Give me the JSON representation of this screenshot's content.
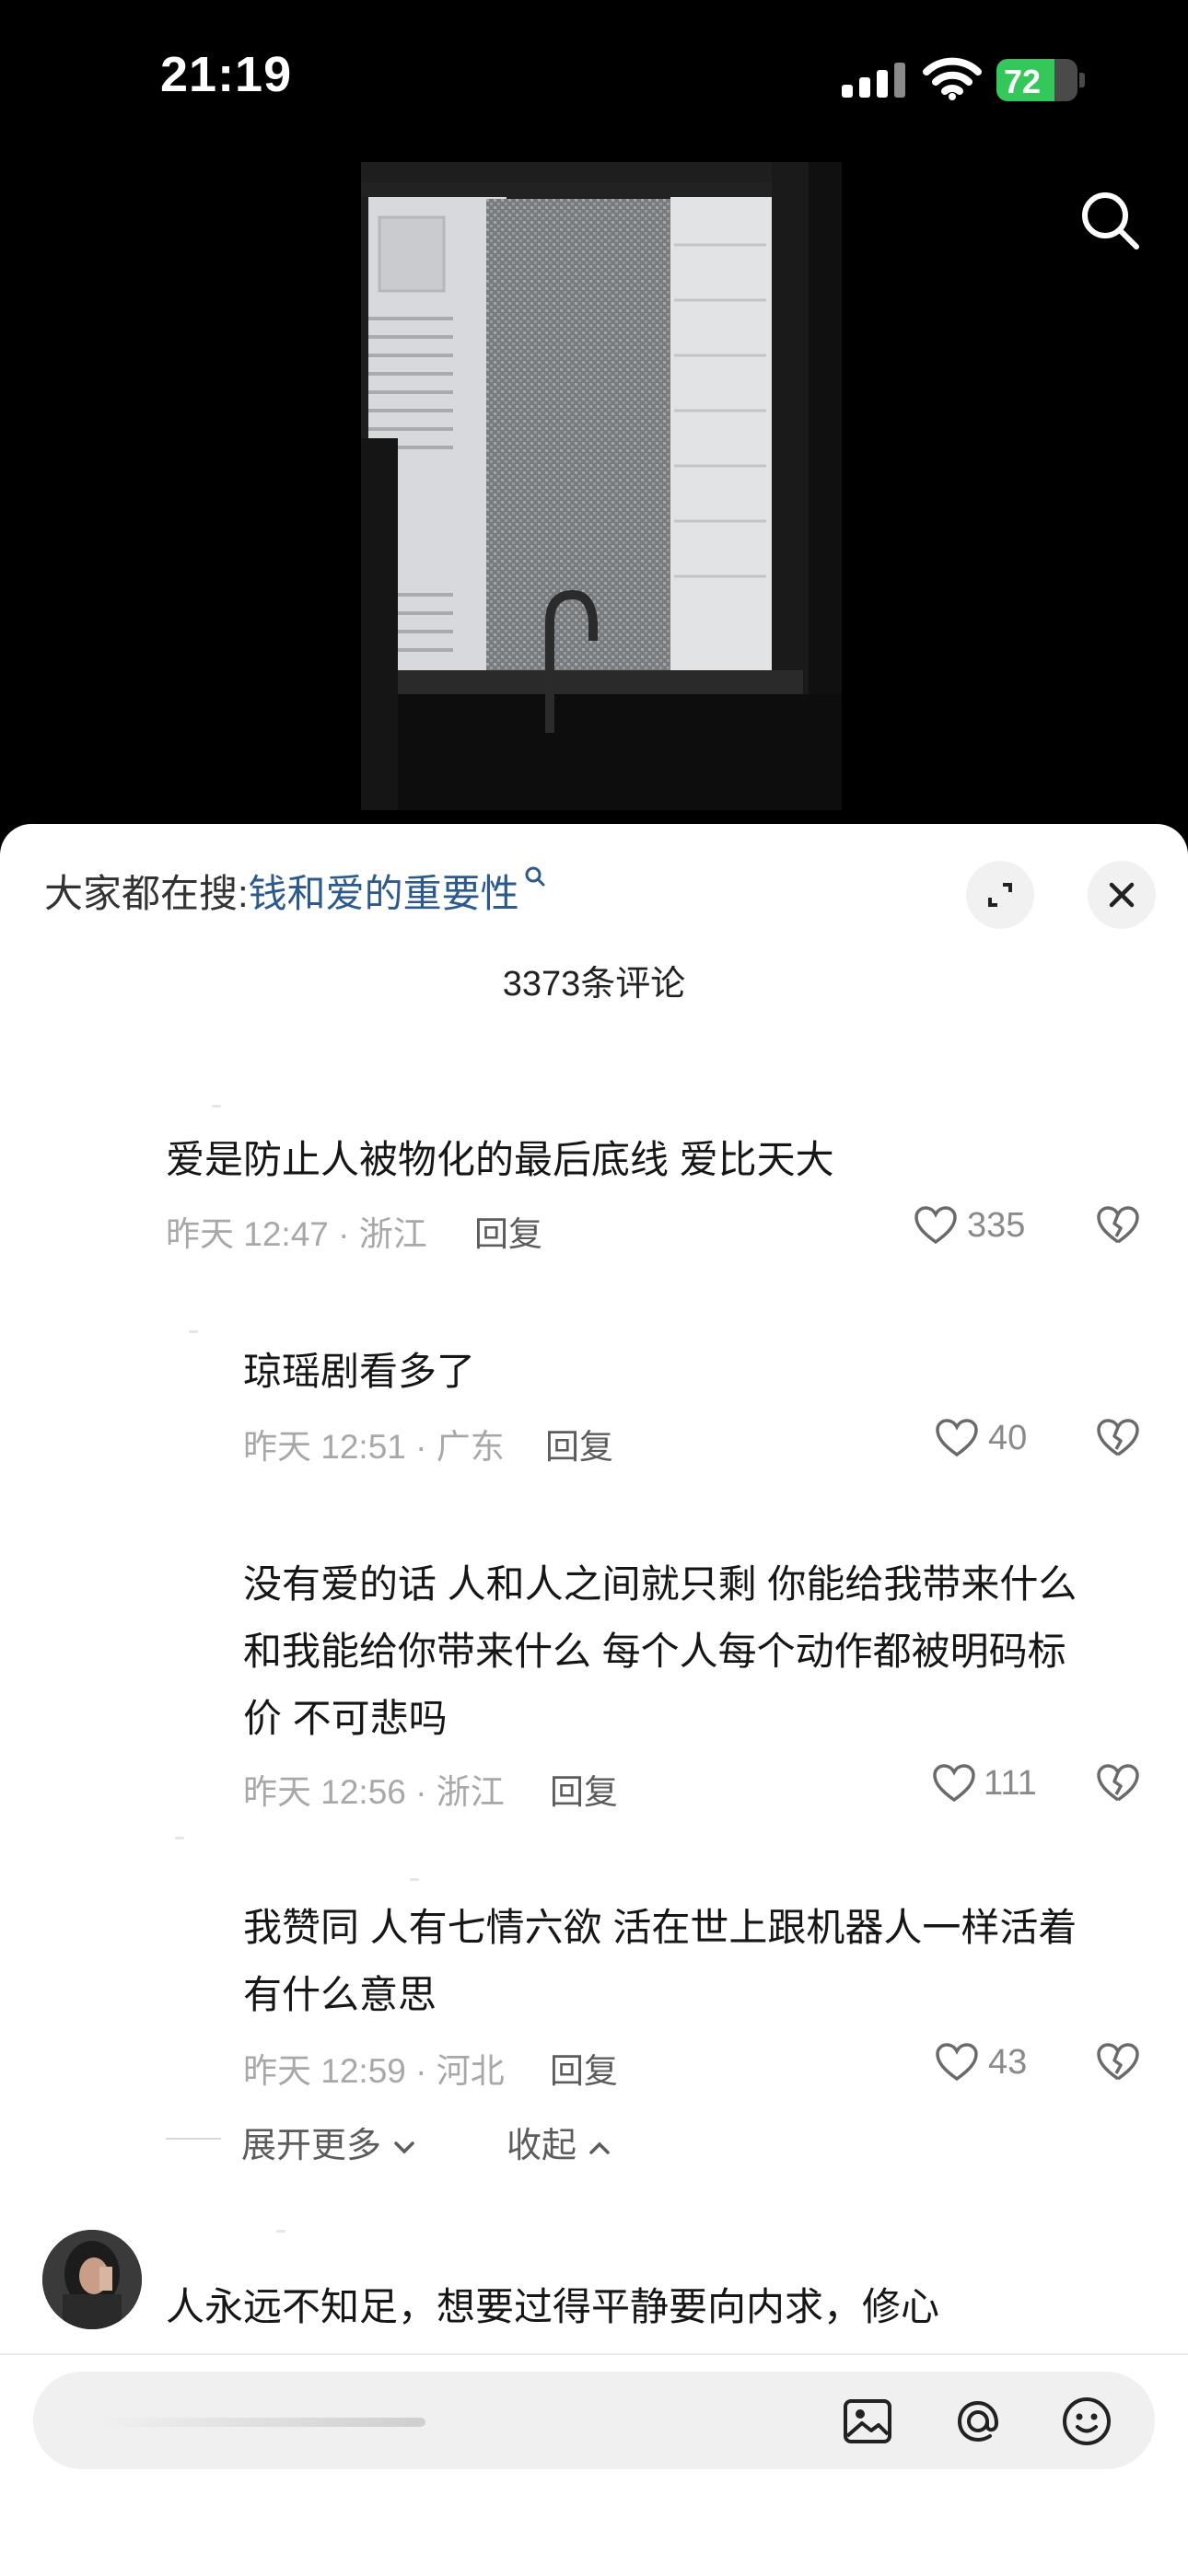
{
  "status_bar": {
    "time": "21:19",
    "battery": "72",
    "battery_level": 0.72
  },
  "colors": {
    "accent_link": "#2c5a8c",
    "battery_green": "#34c759",
    "meta_gray": "#a8a8a8"
  },
  "hot_search": {
    "prefix": "大家都在搜:",
    "keyword": "钱和爱的重要性"
  },
  "comments_count": "3373条评论",
  "comments": [
    {
      "text_lines": [
        "爱是防止人被物化的最后底线 爱比天大"
      ],
      "meta": "昨天 12:47 · 浙江",
      "reply": "回复",
      "likes": "335"
    },
    {
      "text_lines": [
        "琼瑶剧看多了"
      ],
      "meta": "昨天 12:51 · 广东",
      "reply": "回复",
      "likes": "40"
    },
    {
      "text_lines": [
        "没有爱的话 人和人之间就只剩 你能给我带来什么",
        "和我能给你带来什么 每个人每个动作都被明码标",
        "价 不可悲吗"
      ],
      "meta": "昨天 12:56 · 浙江",
      "reply": "回复",
      "likes": "111"
    },
    {
      "text_lines": [
        "我赞同 人有七情六欲 活在世上跟机器人一样活着",
        "有什么意思"
      ],
      "meta": "昨天 12:59 · 河北",
      "reply": "回复",
      "likes": "43"
    }
  ],
  "expand": {
    "more": "展开更多",
    "collapse": "收起"
  },
  "next_comment": {
    "text": "人永远不知足，想要过得平静要向内求，修心"
  },
  "icons": [
    "search-icon",
    "expand-icon",
    "close-icon",
    "heart-icon",
    "broken-heart-icon",
    "image-icon",
    "at-icon",
    "emoji-icon",
    "chevron-down-icon",
    "chevron-up-icon"
  ]
}
